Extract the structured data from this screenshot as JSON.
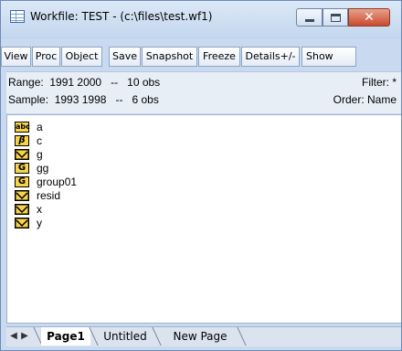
{
  "window": {
    "title": "Workfile: TEST - (c:\\files\\test.wf1)",
    "controls": {
      "minimize": "minimize",
      "maximize": "maximize",
      "close": "✕"
    }
  },
  "toolbar": {
    "buttons": [
      "View",
      "Proc",
      "Object",
      "Save",
      "Snapshot",
      "Freeze",
      "Details+/-",
      "Show"
    ]
  },
  "info": {
    "range_label": "Range:",
    "range_value": "1991 2000",
    "range_sep": "--",
    "range_obs": "10 obs",
    "filter": "Filter: *",
    "sample_label": "Sample:",
    "sample_value": "1993 1998",
    "sample_sep": "--",
    "sample_obs": "6 obs",
    "order": "Order: Name"
  },
  "objects": [
    {
      "icon": "alpha-series-icon",
      "icon_text": "abc",
      "name": "a"
    },
    {
      "icon": "coefficient-icon",
      "icon_text": "β",
      "name": "c"
    },
    {
      "icon": "series-icon",
      "icon_text": "",
      "name": "g"
    },
    {
      "icon": "group-icon",
      "icon_text": "G",
      "name": "gg"
    },
    {
      "icon": "group-icon",
      "icon_text": "G",
      "name": "group01"
    },
    {
      "icon": "series-icon",
      "icon_text": "",
      "name": "resid"
    },
    {
      "icon": "series-icon",
      "icon_text": "",
      "name": "x"
    },
    {
      "icon": "series-icon",
      "icon_text": "",
      "name": "y"
    }
  ],
  "tabs": {
    "prev_arrow": "◀",
    "next_arrow": "▶",
    "pages": [
      "Page1",
      "Untitled",
      "New Page"
    ],
    "active_index": 0
  },
  "colors": {
    "titlebar": "#c3d6ee",
    "close_button": "#c84a2f",
    "icon_fill": "#f6d44a"
  }
}
